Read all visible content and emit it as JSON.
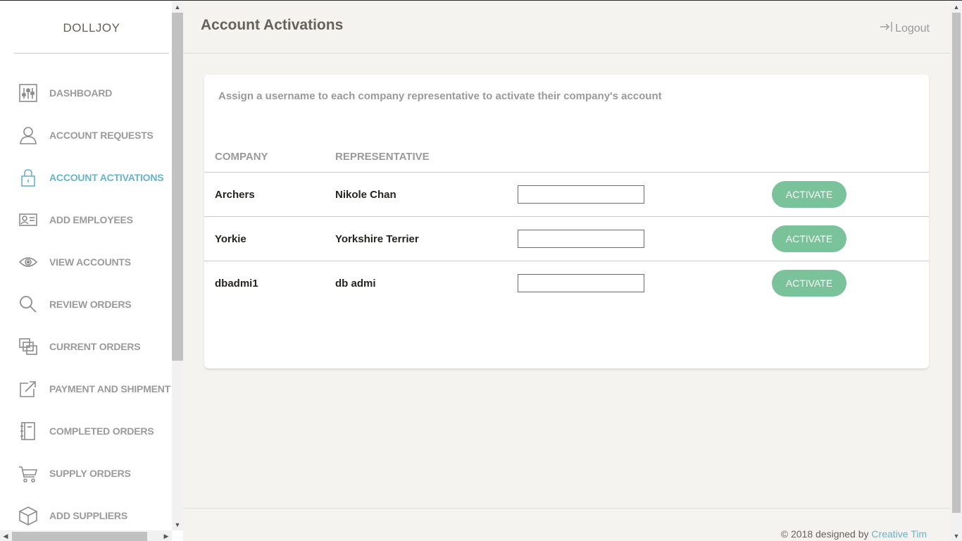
{
  "brand": "DOLLJOY",
  "sidebar": {
    "items": [
      {
        "label": "DASHBOARD",
        "icon": "sliders-icon",
        "active": false
      },
      {
        "label": "ACCOUNT REQUESTS",
        "icon": "user-icon",
        "active": false
      },
      {
        "label": "ACCOUNT ACTIVATIONS",
        "icon": "lock-icon",
        "active": true
      },
      {
        "label": "ADD EMPLOYEES",
        "icon": "id-card-icon",
        "active": false
      },
      {
        "label": "VIEW ACCOUNTS",
        "icon": "eye-icon",
        "active": false
      },
      {
        "label": "REVIEW ORDERS",
        "icon": "search-icon",
        "active": false
      },
      {
        "label": "CURRENT ORDERS",
        "icon": "layers-icon",
        "active": false
      },
      {
        "label": "PAYMENT AND SHIPMENT",
        "icon": "share-icon",
        "active": false
      },
      {
        "label": "COMPLETED ORDERS",
        "icon": "notebook-icon",
        "active": false
      },
      {
        "label": "SUPPLY ORDERS",
        "icon": "cart-icon",
        "active": false
      },
      {
        "label": "ADD SUPPLIERS",
        "icon": "box-icon",
        "active": false
      }
    ]
  },
  "header": {
    "title": "Account Activations",
    "logout_label": "Logout"
  },
  "card": {
    "description": "Assign a username to each company representative to activate their company's account",
    "columns": [
      "COMPANY",
      "REPRESENTATIVE"
    ],
    "rows": [
      {
        "company": "Archers",
        "representative": "Nikole Chan",
        "username": "",
        "button": "ACTIVATE"
      },
      {
        "company": "Yorkie",
        "representative": "Yorkshire Terrier",
        "username": "",
        "button": "ACTIVATE"
      },
      {
        "company": "dbadmi1",
        "representative": "db admi",
        "username": "",
        "button": "ACTIVATE"
      }
    ]
  },
  "footer": {
    "prefix": "© 2018 designed by ",
    "link": "Creative Tim"
  },
  "colors": {
    "active_nav": "#68b3c8",
    "activate_button": "#7ac29a",
    "background": "#f4f3ef"
  }
}
